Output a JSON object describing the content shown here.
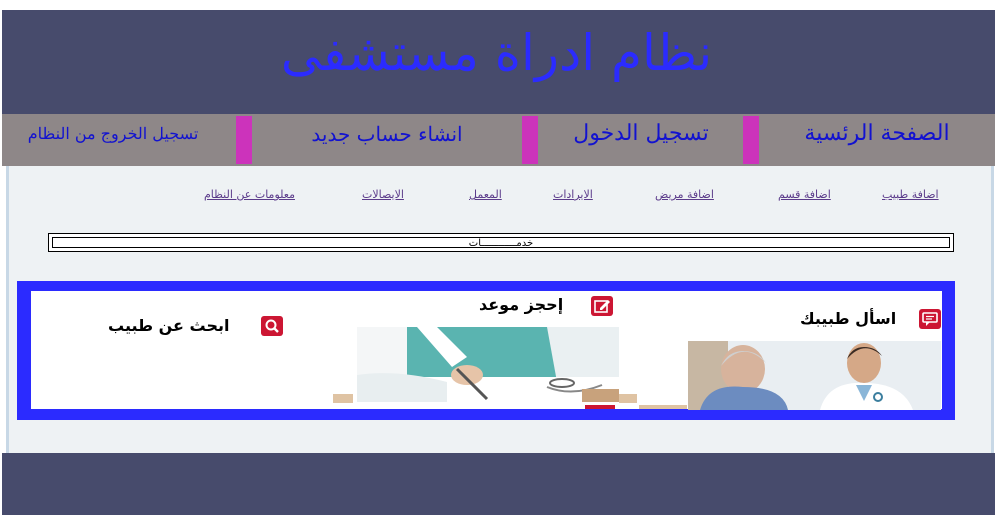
{
  "header": {
    "title": "نظام ادراة مستشفى"
  },
  "nav": {
    "home": "الصفحة الرئسية",
    "login": "تسجيل الدخول",
    "register": "انشاء حساب جديد",
    "logout": "تسجيل الخروج من النظام"
  },
  "links": [
    "اضافة طبيب",
    "اضافة قسم",
    "اضافة مريض",
    "الايرادات",
    "المعمل",
    "الايصالات",
    "معلومات عن النظام"
  ],
  "services_label": "خدمــــــــــــات",
  "cards": {
    "ask": {
      "title": "اسأل طبيبك",
      "icon": "chat-icon"
    },
    "book": {
      "title": "إحجز موعد",
      "icon": "edit-icon"
    },
    "search": {
      "title": "ابحث عن طبيب",
      "icon": "search-icon"
    }
  },
  "colors": {
    "header_bg": "#474b6c",
    "nav_bg": "#8e8788",
    "title_text": "#2b2bff",
    "separator": "#cc33bb",
    "panel_border": "#2b2bff",
    "icon_bg": "#cc1633"
  }
}
